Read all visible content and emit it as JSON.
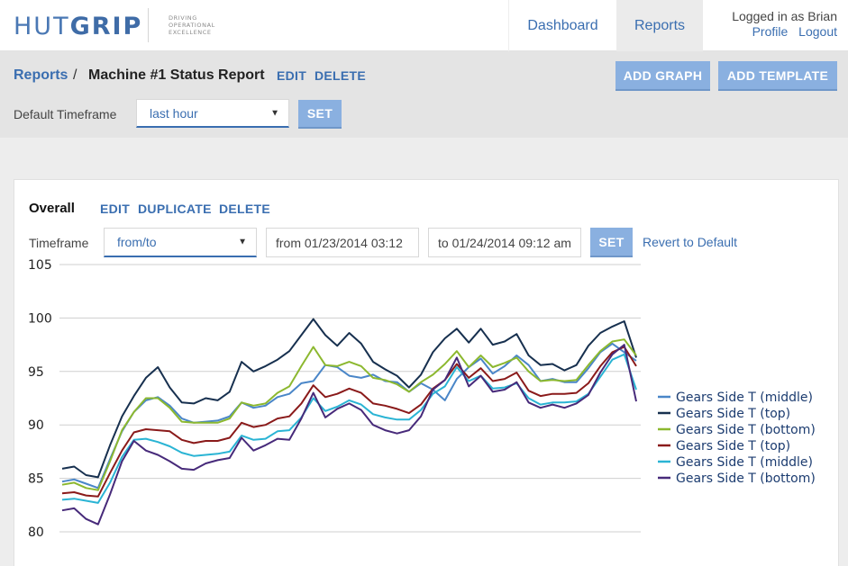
{
  "header": {
    "logo_light": "HUT",
    "logo_bold": "GRIP",
    "tagline": [
      "DRIVING",
      "OPERATIONAL",
      "EXCELLENCE"
    ],
    "nav": [
      {
        "label": "Dashboard",
        "active": false
      },
      {
        "label": "Reports",
        "active": true
      }
    ],
    "user": {
      "logged_in_text": "Logged in as Brian",
      "profile_label": "Profile",
      "logout_label": "Logout"
    }
  },
  "breadcrumb": {
    "root_label": "Reports",
    "separator": "/",
    "title": "Machine #1 Status Report",
    "edit_label": "EDIT",
    "delete_label": "DELETE",
    "add_graph_label": "ADD GRAPH",
    "add_template_label": "ADD TEMPLATE",
    "timeframe_label": "Default Timeframe",
    "timeframe_value": "last hour",
    "set_label": "SET"
  },
  "graph_card": {
    "title": "Overall",
    "edit_label": "EDIT",
    "duplicate_label": "DUPLICATE",
    "delete_label": "DELETE",
    "timeframe_label": "Timeframe",
    "timeframe_value": "from/to",
    "from_value": "from 01/23/2014 03:12",
    "to_value": "to 01/24/2014 09:12 am",
    "set_label": "SET",
    "revert_label": "Revert to Default"
  },
  "chart_data": {
    "type": "line",
    "ylim": [
      80,
      105
    ],
    "yticks": [
      80,
      85,
      90,
      95,
      100,
      105
    ],
    "grid": true,
    "legend_position": "right",
    "series": [
      {
        "name": "Gears Side T (middle)",
        "color": "#4a86c8",
        "values": [
          84.7,
          84.9,
          84.5,
          84.1,
          86.8,
          89.4,
          91.2,
          92.3,
          92.6,
          91.8,
          90.6,
          90.2,
          90.3,
          90.4,
          90.8,
          92.1,
          91.6,
          91.8,
          92.6,
          92.9,
          93.9,
          94.1,
          95.6,
          95.4,
          94.6,
          94.4,
          94.7,
          94.1,
          94.0,
          93.1,
          93.9,
          93.3,
          92.3,
          94.3,
          95.4,
          96.2,
          94.8,
          95.5,
          96.5,
          95.6,
          94.1,
          94.3,
          94.0,
          94.0,
          95.3,
          96.8,
          97.6,
          96.8,
          96.0
        ]
      },
      {
        "name": "Gears Side T (top)",
        "color": "#17304f",
        "values": [
          85.9,
          86.1,
          85.3,
          85.1,
          88.1,
          90.8,
          92.7,
          94.4,
          95.4,
          93.5,
          92.1,
          92.0,
          92.5,
          92.3,
          93.1,
          95.9,
          95.0,
          95.5,
          96.1,
          96.9,
          98.4,
          99.9,
          98.4,
          97.4,
          98.6,
          97.6,
          95.9,
          95.2,
          94.6,
          93.5,
          94.7,
          96.8,
          98.1,
          99.0,
          97.7,
          99.0,
          97.5,
          97.8,
          98.5,
          96.5,
          95.6,
          95.7,
          95.1,
          95.6,
          97.4,
          98.6,
          99.2,
          99.7,
          96.3
        ]
      },
      {
        "name": "Gears Side T (bottom)",
        "color": "#8cb82f",
        "values": [
          84.4,
          84.6,
          84.1,
          83.9,
          86.6,
          89.5,
          91.2,
          92.5,
          92.5,
          91.6,
          90.3,
          90.2,
          90.2,
          90.2,
          90.6,
          92.1,
          91.8,
          92.0,
          93.0,
          93.6,
          95.5,
          97.3,
          95.6,
          95.5,
          95.9,
          95.5,
          94.4,
          94.2,
          93.8,
          93.1,
          94.0,
          94.7,
          95.7,
          96.9,
          95.4,
          96.5,
          95.4,
          95.8,
          96.3,
          95.0,
          94.1,
          94.2,
          94.1,
          94.2,
          95.6,
          96.9,
          97.8,
          98.0,
          96.5
        ]
      },
      {
        "name": "Gears Side T (top)",
        "color": "#8a1a1a",
        "values": [
          83.6,
          83.7,
          83.4,
          83.3,
          85.5,
          87.6,
          89.3,
          89.6,
          89.5,
          89.4,
          88.6,
          88.3,
          88.5,
          88.5,
          88.8,
          90.2,
          89.8,
          90.0,
          90.6,
          90.8,
          92.0,
          93.7,
          92.6,
          92.9,
          93.4,
          93.0,
          92.0,
          91.8,
          91.5,
          91.1,
          91.9,
          93.4,
          94.2,
          95.7,
          94.4,
          95.3,
          94.1,
          94.3,
          94.9,
          93.2,
          92.7,
          92.9,
          92.9,
          93.0,
          93.9,
          95.5,
          96.8,
          97.3,
          95.5
        ]
      },
      {
        "name": "Gears Side T (middle)",
        "color": "#2ab4d4",
        "values": [
          83.0,
          83.1,
          82.9,
          82.7,
          84.6,
          87.0,
          88.6,
          88.7,
          88.4,
          88.0,
          87.4,
          87.1,
          87.2,
          87.3,
          87.5,
          89.0,
          88.6,
          88.7,
          89.4,
          89.5,
          90.7,
          92.5,
          91.3,
          91.7,
          92.3,
          91.9,
          91.0,
          90.7,
          90.5,
          90.5,
          91.4,
          92.9,
          93.6,
          95.4,
          94.1,
          94.6,
          93.4,
          93.5,
          93.9,
          92.5,
          91.9,
          92.1,
          92.1,
          92.2,
          92.9,
          94.5,
          96.1,
          96.6,
          93.3
        ]
      },
      {
        "name": "Gears Side T (bottom)",
        "color": "#472a7a",
        "values": [
          82.0,
          82.2,
          81.2,
          80.7,
          83.5,
          86.6,
          88.5,
          87.6,
          87.2,
          86.6,
          85.9,
          85.8,
          86.4,
          86.7,
          86.9,
          88.8,
          87.6,
          88.1,
          88.7,
          88.6,
          90.6,
          93.0,
          90.7,
          91.5,
          92.0,
          91.4,
          90.0,
          89.5,
          89.2,
          89.5,
          90.8,
          93.3,
          94.2,
          96.3,
          93.6,
          94.6,
          93.1,
          93.3,
          94.0,
          92.1,
          91.6,
          91.9,
          91.6,
          92.0,
          92.8,
          94.9,
          96.6,
          97.5,
          92.2
        ]
      }
    ]
  }
}
